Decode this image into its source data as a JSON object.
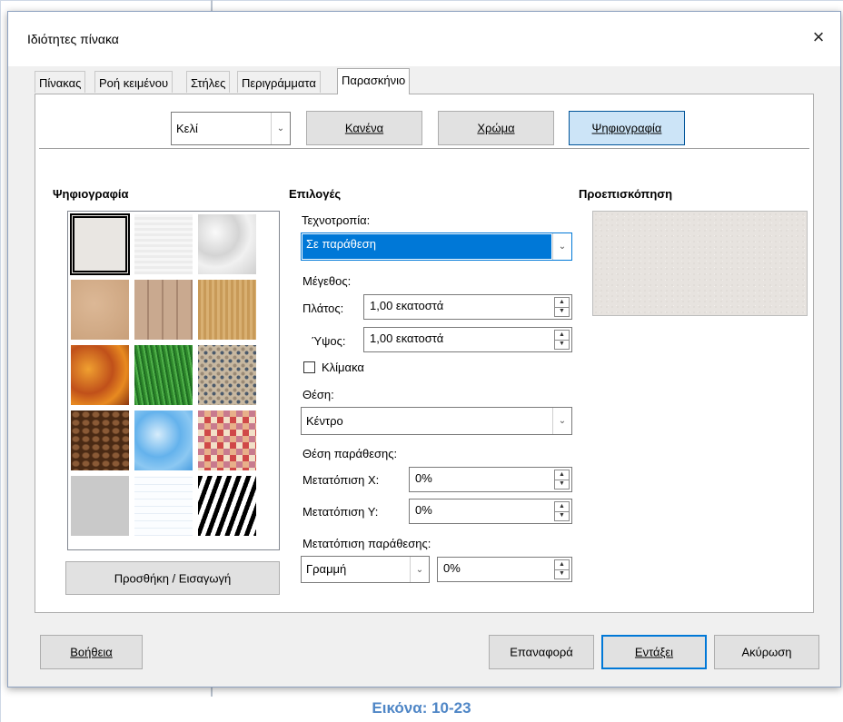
{
  "dialog": {
    "title": "Ιδιότητες πίνακα",
    "close_glyph": "×"
  },
  "tabs": [
    {
      "label": "Πίνακας",
      "active": false
    },
    {
      "label": "Ροή κειμένου",
      "active": false
    },
    {
      "label": "Στήλες",
      "active": false
    },
    {
      "label": "Περιγράμματα",
      "active": false
    },
    {
      "label": "Παρασκήνιο",
      "active": true
    }
  ],
  "background_type": {
    "target_combo_value": "Κελί",
    "buttons": [
      {
        "label": "Κανένα",
        "pressed": false
      },
      {
        "label": "Χρώμα",
        "pressed": false
      },
      {
        "label": "Ψηφιογραφία",
        "pressed": true
      }
    ]
  },
  "bitmap_section": {
    "heading": "Ψηφιογραφία",
    "add_button": "Προσθήκη / Εισαγωγή",
    "tiles": [
      {
        "name": "painted-white",
        "selected": true
      },
      {
        "name": "paper-texture",
        "selected": false
      },
      {
        "name": "paper-crumpled",
        "selected": false
      },
      {
        "name": "paper-graph",
        "selected": false
      },
      {
        "name": "parchment-paper",
        "selected": false
      },
      {
        "name": "fence",
        "selected": false
      },
      {
        "name": "wooden-board",
        "selected": false
      },
      {
        "name": "maple-leaves",
        "selected": false
      },
      {
        "name": "lawn",
        "selected": false
      },
      {
        "name": "colorful-pebbles",
        "selected": false
      },
      {
        "name": "coffee-beans",
        "selected": false
      },
      {
        "name": "sky",
        "selected": false
      },
      {
        "name": "color-stripes",
        "selected": false
      },
      {
        "name": "concrete",
        "selected": false
      },
      {
        "name": "grid",
        "selected": false
      },
      {
        "name": "zebra",
        "selected": false
      }
    ]
  },
  "options": {
    "heading": "Επιλογές",
    "style_label": "Τεχνοτροπία:",
    "style_value": "Σε παράθεση",
    "size_label": "Μέγεθος:",
    "width_label": "Πλάτος:",
    "width_value": "1,00 εκατοστά",
    "height_label": "Ύψος:",
    "height_value": "1,00 εκατοστά",
    "scale_label": "Κλίμακα",
    "scale_checked": false,
    "position_label": "Θέση:",
    "position_value": "Κέντρο",
    "tile_position_label": "Θέση παράθεσης:",
    "offset_x_label": "Μετατόπιση Χ:",
    "offset_x_value": "0%",
    "offset_y_label": "Μετατόπιση Υ:",
    "offset_y_value": "0%",
    "tile_offset_label": "Μετατόπιση παράθεσης:",
    "tile_offset_mode": "Γραμμή",
    "tile_offset_value": "0%"
  },
  "preview": {
    "heading": "Προεπισκόπηση"
  },
  "footer": {
    "help": "Βοήθεια",
    "reset": "Επαναφορά",
    "ok": "Εντάξει",
    "cancel": "Ακύρωση"
  },
  "caption": "Εικόνα: 10-23",
  "colors": {
    "accent": "#0078d7",
    "caption": "#4f86c6",
    "dialog_bg": "#f0f0f0"
  }
}
